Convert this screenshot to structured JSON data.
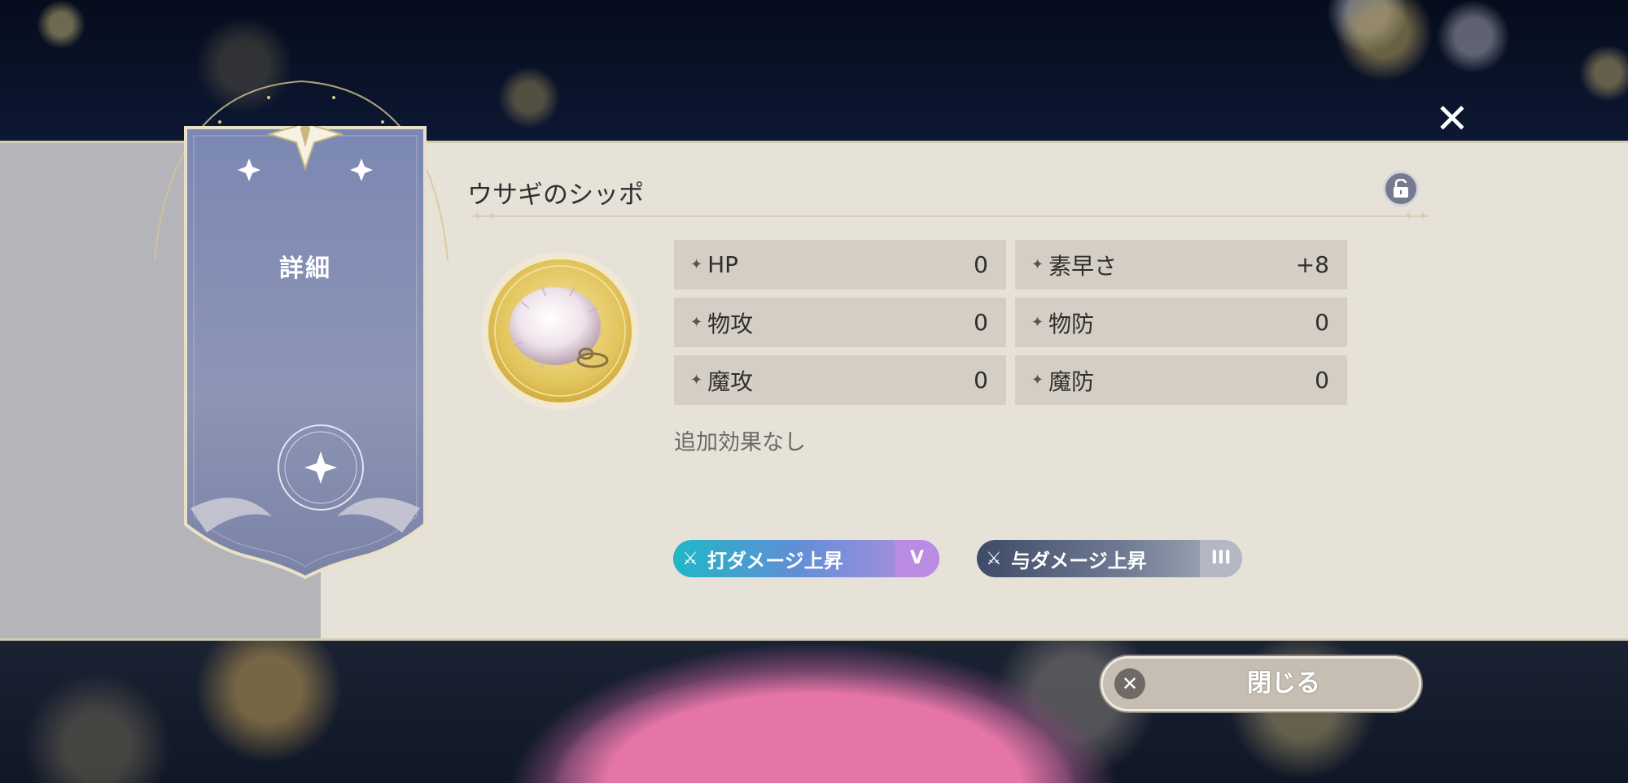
{
  "panel": {
    "tab_title": "詳細",
    "item_name": "ウサギのシッポ",
    "close_icon": "✕",
    "lock_icon": "unlock-icon"
  },
  "stats": {
    "hp": {
      "label": "HP",
      "value": "0"
    },
    "speed": {
      "label": "素早さ",
      "value": "+8"
    },
    "patk": {
      "label": "物攻",
      "value": "0"
    },
    "pdef": {
      "label": "物防",
      "value": "0"
    },
    "matk": {
      "label": "魔攻",
      "value": "0"
    },
    "mdef": {
      "label": "魔防",
      "value": "0"
    }
  },
  "extra_effect": "追加効果なし",
  "tags": [
    {
      "label": "打ダメージ上昇",
      "level": "V",
      "color": "#20b7c6"
    },
    {
      "label": "与ダメージ上昇",
      "level": "III",
      "color": "#3f4a68"
    }
  ],
  "close_button": {
    "label": "閉じる",
    "icon": "✕"
  }
}
